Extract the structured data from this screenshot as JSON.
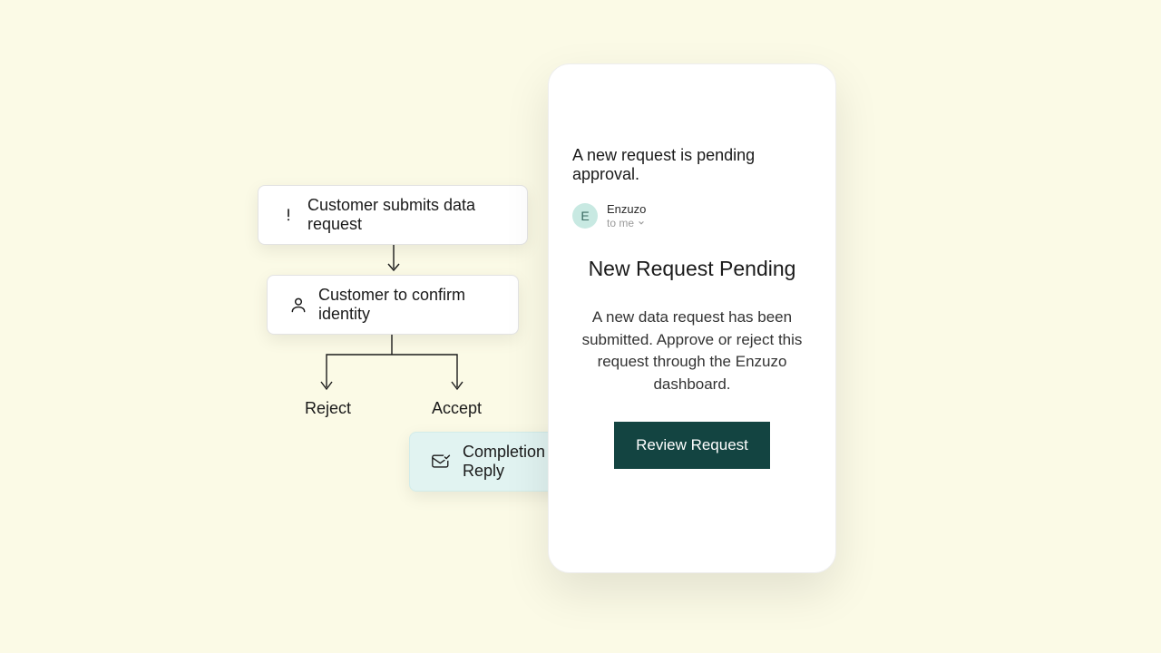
{
  "flow": {
    "step1_label": "Customer submits data request",
    "step2_label": "Customer to confirm identity",
    "reject_label": "Reject",
    "accept_label": "Accept",
    "completion_label": "Completion Reply"
  },
  "notification": {
    "subject": "A new request is pending approval.",
    "sender_initial": "E",
    "sender_name": "Enzuzo",
    "sender_recipient": "to me",
    "title": "New Request Pending",
    "body": "A new data request has been submitted. Approve or reject this request through the Enzuzo dashboard.",
    "button_label": "Review Request"
  },
  "colors": {
    "background": "#fbfae6",
    "card_bg": "#ffffff",
    "completion_bg": "#e1f3f1",
    "button_bg": "#134441",
    "avatar_bg": "#c8e9e2"
  }
}
